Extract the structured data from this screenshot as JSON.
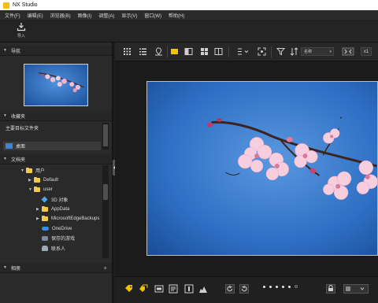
{
  "window": {
    "title": "NX Studio"
  },
  "menu": [
    "文件(F)",
    "编辑(E)",
    "浏览器(B)",
    "图像(I)",
    "调整(A)",
    "显示(V)",
    "窗口(W)",
    "帮助(H)"
  ],
  "toolbar": {
    "import_label": "导入"
  },
  "panels": {
    "navigator": {
      "title": "导航"
    },
    "favorites": {
      "title": "收藏夹",
      "items": [
        {
          "label": "主要目标文件夹"
        },
        {
          "label": "桌面"
        }
      ]
    },
    "browser": {
      "title": "文档夹",
      "tree": [
        {
          "label": "用户",
          "indent": 0,
          "arrow": "▼",
          "icon": "folder-icon"
        },
        {
          "label": "Default",
          "indent": 1,
          "arrow": "▶",
          "icon": "folder-icon"
        },
        {
          "label": "user",
          "indent": 1,
          "arrow": "▼",
          "icon": "folder-icon"
        },
        {
          "label": "3D 对象",
          "indent": 2,
          "arrow": "",
          "icon": "cube-icon"
        },
        {
          "label": "AppData",
          "indent": 2,
          "arrow": "▶",
          "icon": "folder-icon"
        },
        {
          "label": "MicrosoftEdgeBackups",
          "indent": 2,
          "arrow": "▶",
          "icon": "folder-icon"
        },
        {
          "label": "OneDrive",
          "indent": 2,
          "arrow": "",
          "icon": "cloud-icon"
        },
        {
          "label": "保存的游戏",
          "indent": 2,
          "arrow": "",
          "icon": "game-icon"
        },
        {
          "label": "联系人",
          "indent": 2,
          "arrow": "",
          "icon": "contacts-icon"
        }
      ]
    },
    "bottom": {
      "title": "相册"
    }
  },
  "viewer": {
    "sort_label": "名称",
    "zoom_label": "x1",
    "rating_dots": 5
  },
  "colors": {
    "accent": "#f2c200",
    "sky": "#1f61b8",
    "folder": "#f2c94c"
  }
}
